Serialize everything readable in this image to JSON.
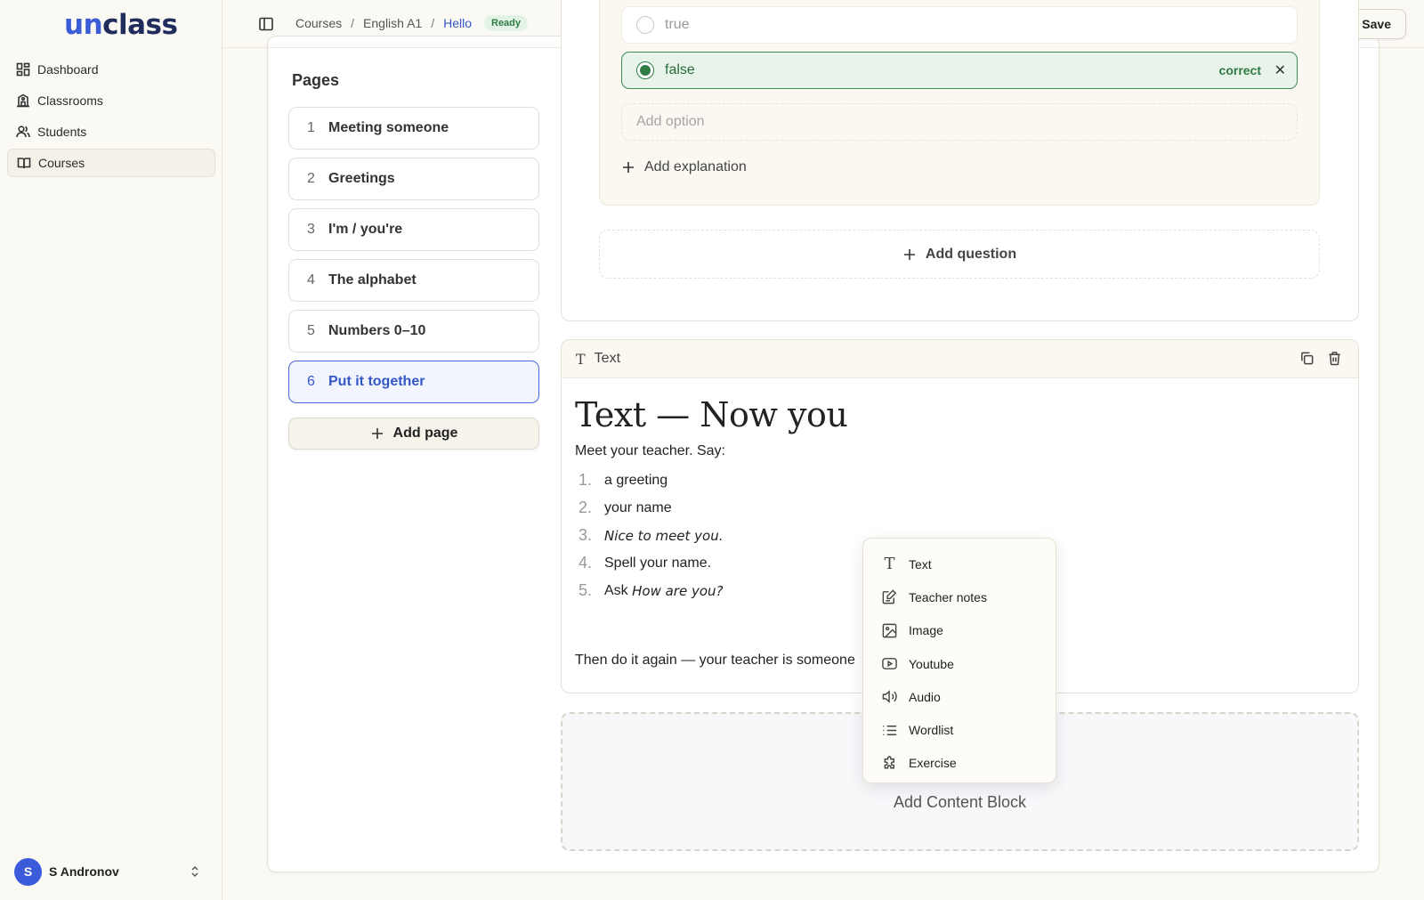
{
  "brand": {
    "logo_prefix": "un",
    "logo_suffix": "class"
  },
  "sidebar": {
    "items": [
      {
        "label": "Dashboard",
        "icon": "grid-icon"
      },
      {
        "label": "Classrooms",
        "icon": "school-icon"
      },
      {
        "label": "Students",
        "icon": "users-icon"
      },
      {
        "label": "Courses",
        "icon": "book-icon",
        "active": true
      }
    ],
    "user": {
      "initial": "S",
      "name": "S Andronov"
    }
  },
  "header": {
    "breadcrumb": [
      "Courses",
      "English A1",
      "Hello"
    ],
    "status": "Ready",
    "save_label": "Save"
  },
  "pages": {
    "title": "Pages",
    "items": [
      {
        "num": "1",
        "title": "Meeting someone"
      },
      {
        "num": "2",
        "title": "Greetings"
      },
      {
        "num": "3",
        "title": "I'm / you're"
      },
      {
        "num": "4",
        "title": "The alphabet"
      },
      {
        "num": "5",
        "title": "Numbers 0–10"
      },
      {
        "num": "6",
        "title": "Put it together",
        "active": true
      }
    ],
    "add_label": "Add page"
  },
  "question": {
    "options": [
      {
        "text": "true",
        "selected": false
      },
      {
        "text": "false",
        "selected": true,
        "tag": "correct"
      }
    ],
    "add_option_placeholder": "Add option",
    "add_explanation": "Add explanation",
    "add_question": "Add question"
  },
  "text_block": {
    "header": "Text",
    "heading": "Text — Now you",
    "intro": "Meet your teacher. Say:",
    "list": [
      {
        "n": "1.",
        "text": "a greeting"
      },
      {
        "n": "2.",
        "text": "your name"
      },
      {
        "n": "3.",
        "italic": "Nice to meet you."
      },
      {
        "n": "4.",
        "text": "Spell your name."
      },
      {
        "n": "5.",
        "text": "Ask ",
        "italic": "How are you?"
      }
    ],
    "after": "Then do it again — your teacher is someone"
  },
  "add_block": {
    "label": "Add Content Block"
  },
  "menu": {
    "items": [
      {
        "label": "Text",
        "icon": "text-icon"
      },
      {
        "label": "Teacher notes",
        "icon": "notes-icon"
      },
      {
        "label": "Image",
        "icon": "image-icon"
      },
      {
        "label": "Youtube",
        "icon": "youtube-icon"
      },
      {
        "label": "Audio",
        "icon": "audio-icon"
      },
      {
        "label": "Wordlist",
        "icon": "list-icon"
      },
      {
        "label": "Exercise",
        "icon": "puzzle-icon"
      }
    ]
  },
  "colors": {
    "accent": "#3c5bd6",
    "correct": "#2f7a43",
    "background": "#fbf9f4"
  }
}
